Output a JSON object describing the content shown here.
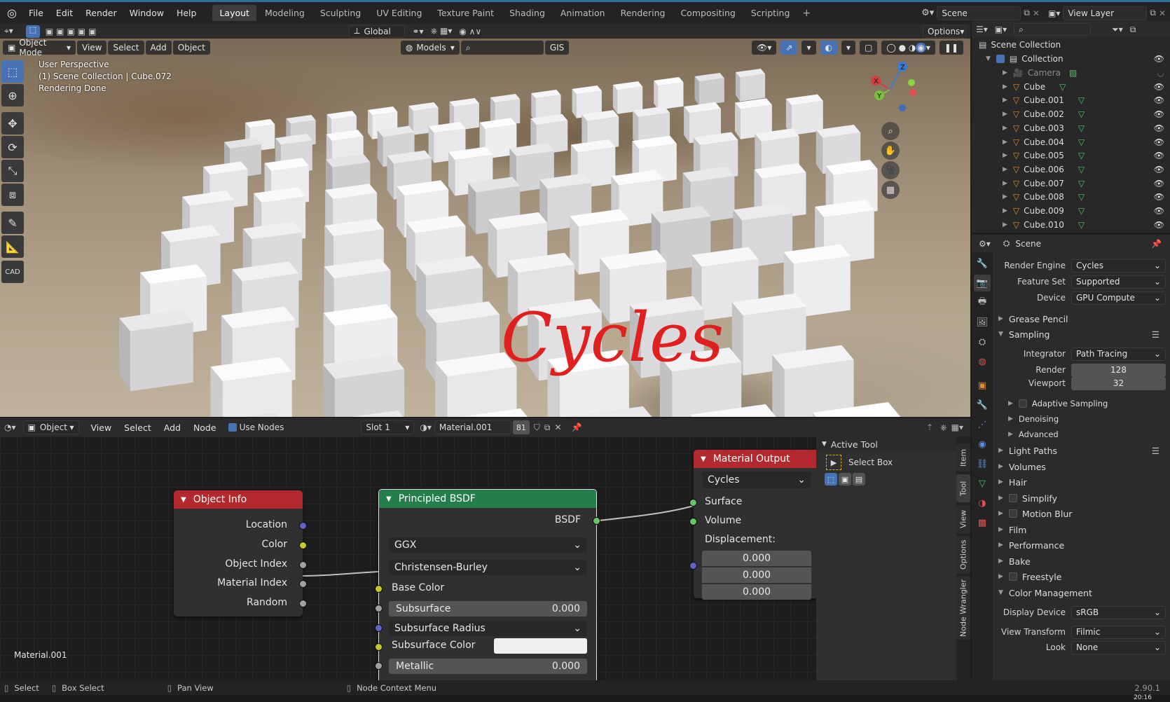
{
  "menu": {
    "items": [
      "File",
      "Edit",
      "Render",
      "Window",
      "Help"
    ]
  },
  "workspaces": {
    "tabs": [
      "Layout",
      "Modeling",
      "Sculpting",
      "UV Editing",
      "Texture Paint",
      "Shading",
      "Animation",
      "Rendering",
      "Compositing",
      "Scripting"
    ],
    "active": "Layout"
  },
  "scene": {
    "name": "Scene",
    "view_layer": "View Layer"
  },
  "viewport_toolbar": {
    "orientation": "Global",
    "options": "Options"
  },
  "viewport_header": {
    "mode": "Object Mode",
    "menus": [
      "View",
      "Select",
      "Add",
      "Object"
    ],
    "models": "Models",
    "gis": "GIS"
  },
  "viewport_overlay": {
    "line1": "User Perspective",
    "line2": "(1) Scene Collection | Cube.072",
    "line3": "Rendering Done",
    "annotation": "Cycles"
  },
  "gizmo": {
    "x": "X",
    "y": "Y",
    "z": "Z"
  },
  "node_header": {
    "editor": "Object",
    "menus": [
      "View",
      "Select",
      "Add",
      "Node"
    ],
    "use_nodes": "Use Nodes",
    "slot": "Slot 1",
    "material": "Material.001",
    "users": "81"
  },
  "nodes": {
    "object_info": {
      "title": "Object Info",
      "outputs": [
        "Location",
        "Color",
        "Object Index",
        "Material Index",
        "Random"
      ]
    },
    "principled": {
      "title": "Principled BSDF",
      "output": "BSDF",
      "distribution": "GGX",
      "subsurface_method": "Christensen-Burley",
      "base_color": "Base Color",
      "subsurface_label": "Subsurface",
      "subsurface_value": "0.000",
      "subsurface_radius": "Subsurface Radius",
      "subsurface_color": "Subsurface Color",
      "metallic_label": "Metallic",
      "metallic_value": "0.000"
    },
    "material_output": {
      "title": "Material Output",
      "target": "Cycles",
      "surface": "Surface",
      "volume": "Volume",
      "displacement": "Displacement:",
      "disp_values": [
        "0.000",
        "0.000",
        "0.000"
      ]
    }
  },
  "node_editor": {
    "material_label": "Material.001"
  },
  "active_tool": {
    "title": "Active Tool",
    "name": "Select Box"
  },
  "side_tabs": [
    "Item",
    "Tool",
    "View",
    "Options",
    "Node Wrangler"
  ],
  "outliner": {
    "root": "Scene Collection",
    "collection": "Collection",
    "items": [
      "Camera",
      "Cube",
      "Cube.001",
      "Cube.002",
      "Cube.003",
      "Cube.004",
      "Cube.005",
      "Cube.006",
      "Cube.007",
      "Cube.008",
      "Cube.009",
      "Cube.010"
    ]
  },
  "properties": {
    "context": "Scene",
    "render_engine": {
      "label": "Render Engine",
      "value": "Cycles"
    },
    "feature_set": {
      "label": "Feature Set",
      "value": "Supported"
    },
    "device": {
      "label": "Device",
      "value": "GPU Compute"
    },
    "grease_pencil": "Grease Pencil",
    "sampling": "Sampling",
    "integrator": {
      "label": "Integrator",
      "value": "Path Tracing"
    },
    "render_samples": {
      "label": "Render",
      "value": "128"
    },
    "viewport_samples": {
      "label": "Viewport",
      "value": "32"
    },
    "adaptive": "Adaptive Sampling",
    "denoising": "Denoising",
    "advanced": "Advanced",
    "light_paths": "Light Paths",
    "volumes": "Volumes",
    "hair": "Hair",
    "simplify": "Simplify",
    "motion_blur": "Motion Blur",
    "film": "Film",
    "performance": "Performance",
    "bake": "Bake",
    "freestyle": "Freestyle",
    "color_management": "Color Management",
    "display_device": {
      "label": "Display Device",
      "value": "sRGB"
    },
    "view_transform": {
      "label": "View Transform",
      "value": "Filmic"
    },
    "look": {
      "label": "Look",
      "value": "None"
    }
  },
  "status": {
    "select": "Select",
    "box_select": "Box Select",
    "pan": "Pan View",
    "context_menu": "Node Context Menu",
    "version": "2.90.1",
    "clock": "20:16"
  },
  "colors": {
    "accent": "#4772b3",
    "node_red": "#b3292d",
    "node_green": "#237e4b",
    "socket_yellow": "#c7c729",
    "socket_violet": "#6363c7",
    "socket_green": "#63c763",
    "socket_gray": "#a1a1a1",
    "annotation": "#e0201e"
  }
}
